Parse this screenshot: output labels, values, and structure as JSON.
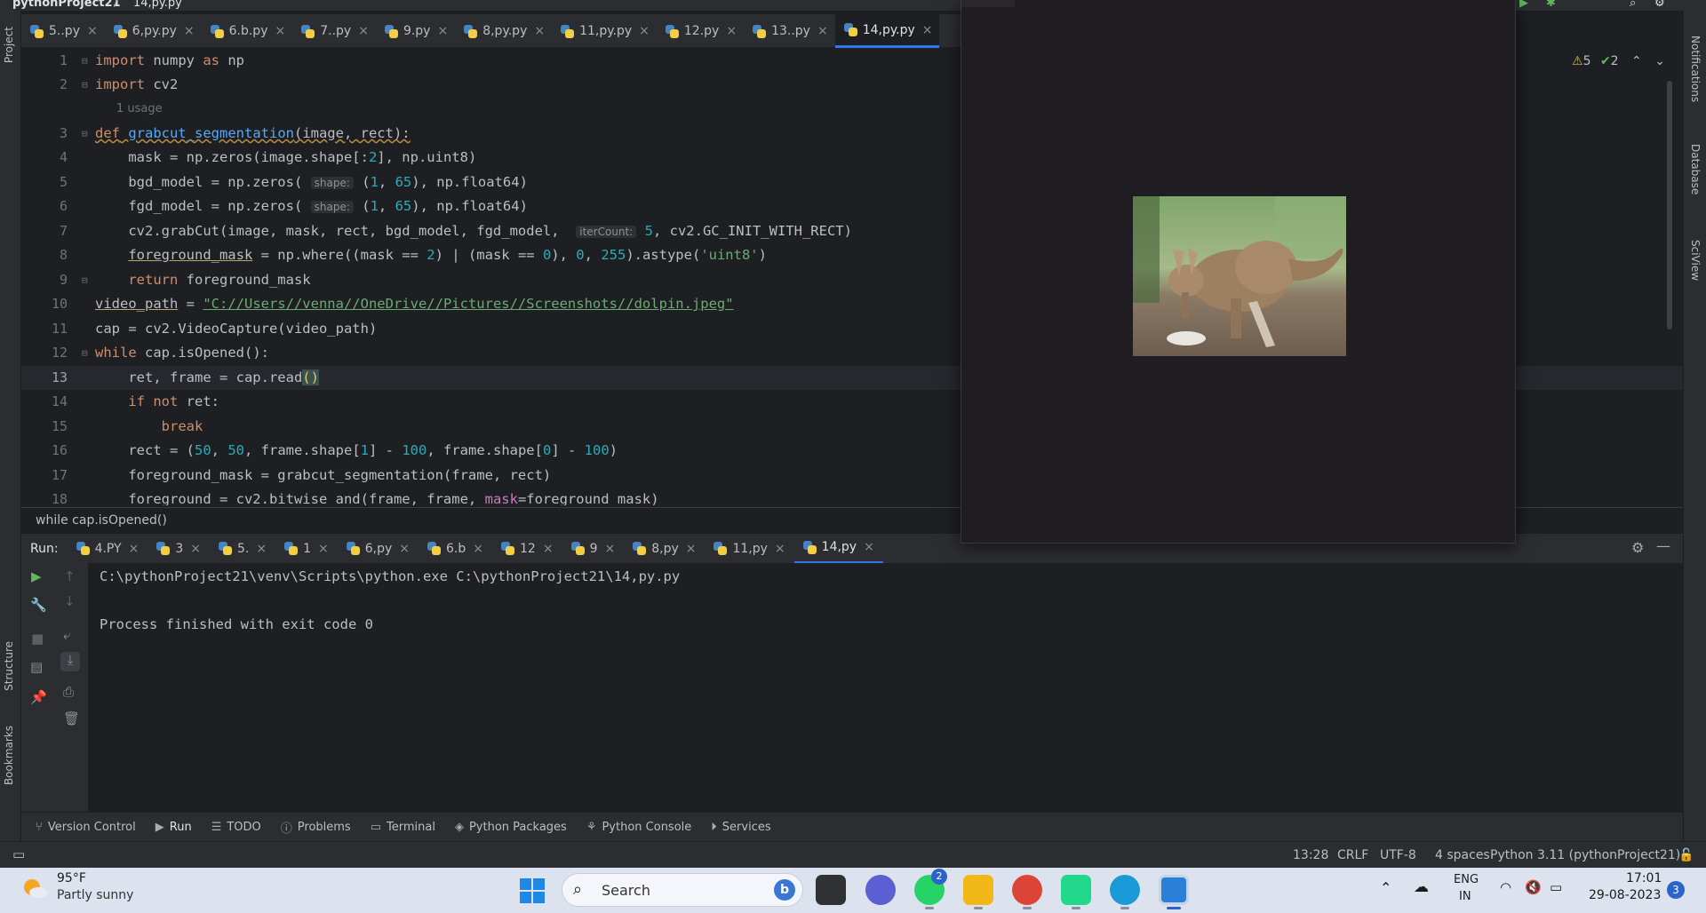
{
  "titlebar": {
    "project": "pythonProject21",
    "file": "14,py.py"
  },
  "editor_tabs": [
    {
      "label": "5..py",
      "active": false
    },
    {
      "label": "6,py.py",
      "active": false
    },
    {
      "label": "6.b.py",
      "active": false
    },
    {
      "label": "7..py",
      "active": false
    },
    {
      "label": "9.py",
      "active": false
    },
    {
      "label": "8,py.py",
      "active": false
    },
    {
      "label": "11,py.py",
      "active": false
    },
    {
      "label": "12.py",
      "active": false
    },
    {
      "label": "13..py",
      "active": false
    },
    {
      "label": "14,py.py",
      "active": true
    }
  ],
  "inspection": {
    "warnings": "5",
    "weak_warnings": "2"
  },
  "code": {
    "usage_hint": "1 usage",
    "hint_shape": "shape:",
    "hint_itercount": "iterCount:",
    "line_numbers": [
      "1",
      "2",
      "3",
      "4",
      "5",
      "6",
      "7",
      "8",
      "9",
      "10",
      "11",
      "12",
      "13",
      "14",
      "15",
      "16",
      "17",
      "18"
    ]
  },
  "breadcrumb": "while cap.isOpened()",
  "run": {
    "label": "Run:",
    "tabs": [
      {
        "label": "4.PY",
        "active": false
      },
      {
        "label": "3",
        "active": false
      },
      {
        "label": "5.",
        "active": false
      },
      {
        "label": "1",
        "active": false
      },
      {
        "label": "6,py",
        "active": false
      },
      {
        "label": "6.b",
        "active": false
      },
      {
        "label": "12",
        "active": false
      },
      {
        "label": "9",
        "active": false
      },
      {
        "label": "8,py",
        "active": false
      },
      {
        "label": "11,py",
        "active": false
      },
      {
        "label": "14,py",
        "active": true
      }
    ],
    "console": [
      "C:\\pythonProject21\\venv\\Scripts\\python.exe C:\\pythonProject21\\14,py.py",
      "",
      "Process finished with exit code 0"
    ]
  },
  "left_strip": {
    "project": "Project",
    "structure": "Structure",
    "bookmarks": "Bookmarks"
  },
  "right_strip": {
    "notifications": "Notifications",
    "database": "Database",
    "sciview": "SciView"
  },
  "tool_tabs": [
    {
      "label": "Version Control",
      "icon": "branch-icon"
    },
    {
      "label": "Run",
      "icon": "play-icon",
      "active": true
    },
    {
      "label": "TODO",
      "icon": "list-icon"
    },
    {
      "label": "Problems",
      "icon": "info-icon"
    },
    {
      "label": "Terminal",
      "icon": "terminal-icon"
    },
    {
      "label": "Python Packages",
      "icon": "packages-icon"
    },
    {
      "label": "Python Console",
      "icon": "python-icon"
    },
    {
      "label": "Services",
      "icon": "services-icon"
    }
  ],
  "status": {
    "position": "13:28",
    "line_sep": "CRLF",
    "encoding": "UTF-8",
    "indent": "4 spaces",
    "interpreter": "Python 3.11 (pythonProject21)"
  },
  "taskbar": {
    "weather_temp": "95°F",
    "weather_desc": "Partly sunny",
    "search_placeholder": "Search",
    "whatsapp_badge": "2",
    "lang": "ENG",
    "region": "IN",
    "time": "17:01",
    "date": "29-08-2023",
    "notif_count": "3"
  }
}
